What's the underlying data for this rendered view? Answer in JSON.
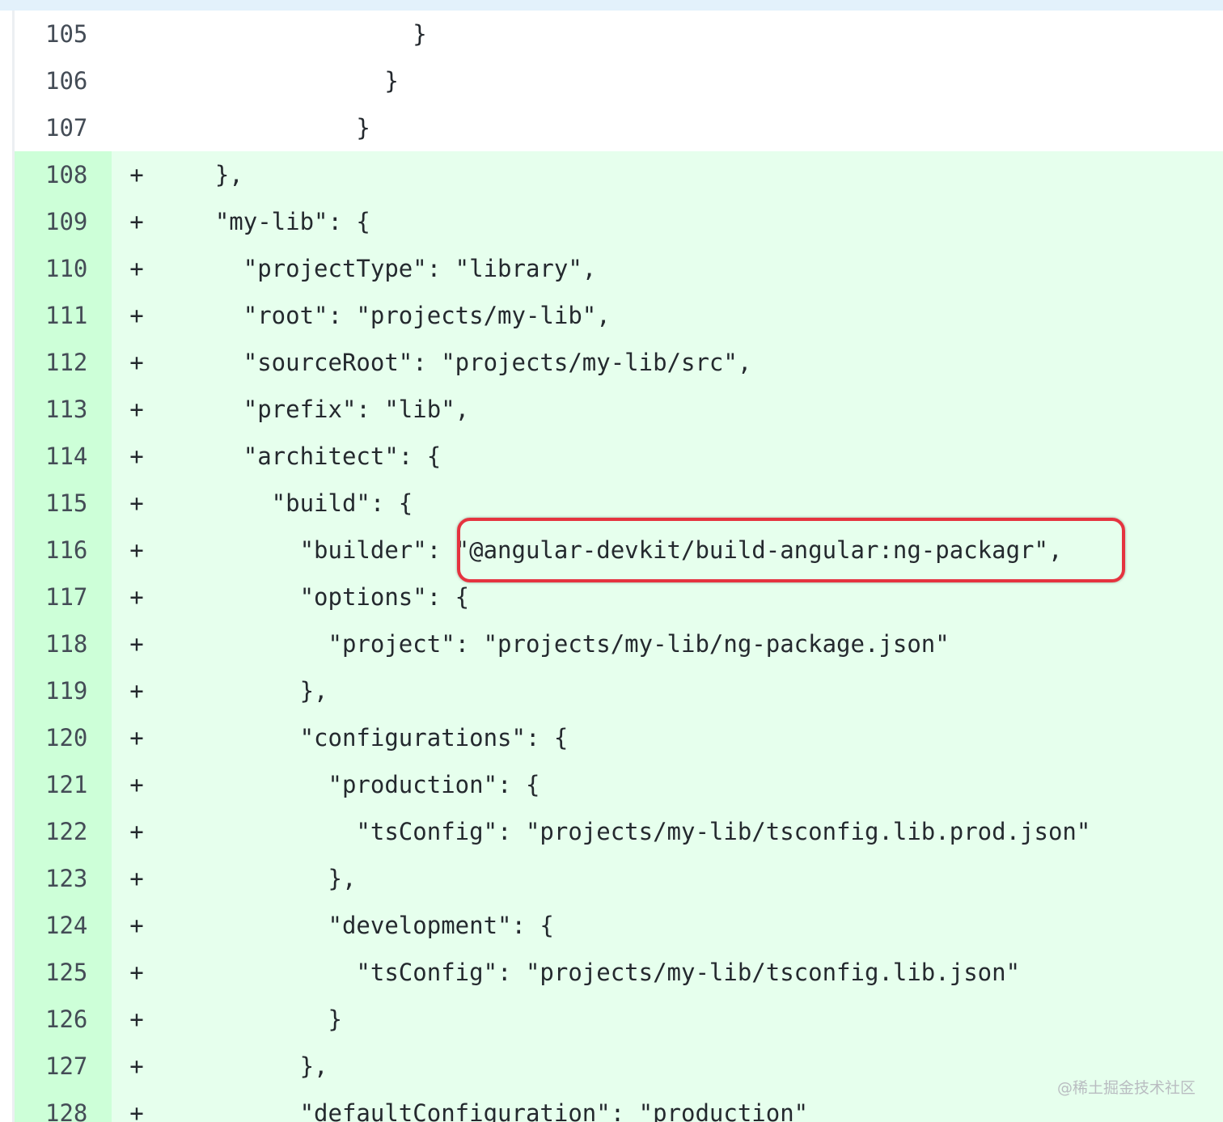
{
  "diff": {
    "lines": [
      {
        "num": "105",
        "sign": "",
        "type": "context",
        "code": "                  }"
      },
      {
        "num": "106",
        "sign": "",
        "type": "context",
        "code": "                }"
      },
      {
        "num": "107",
        "sign": "",
        "type": "context",
        "code": "              }"
      },
      {
        "num": "108",
        "sign": "+",
        "type": "added",
        "code": "    },"
      },
      {
        "num": "109",
        "sign": "+",
        "type": "added",
        "code": "    \"my-lib\": {"
      },
      {
        "num": "110",
        "sign": "+",
        "type": "added",
        "code": "      \"projectType\": \"library\","
      },
      {
        "num": "111",
        "sign": "+",
        "type": "added",
        "code": "      \"root\": \"projects/my-lib\","
      },
      {
        "num": "112",
        "sign": "+",
        "type": "added",
        "code": "      \"sourceRoot\": \"projects/my-lib/src\","
      },
      {
        "num": "113",
        "sign": "+",
        "type": "added",
        "code": "      \"prefix\": \"lib\","
      },
      {
        "num": "114",
        "sign": "+",
        "type": "added",
        "code": "      \"architect\": {"
      },
      {
        "num": "115",
        "sign": "+",
        "type": "added",
        "code": "        \"build\": {"
      },
      {
        "num": "116",
        "sign": "+",
        "type": "added",
        "code": "          \"builder\": \"@angular-devkit/build-angular:ng-packagr\","
      },
      {
        "num": "117",
        "sign": "+",
        "type": "added",
        "code": "          \"options\": {"
      },
      {
        "num": "118",
        "sign": "+",
        "type": "added",
        "code": "            \"project\": \"projects/my-lib/ng-package.json\""
      },
      {
        "num": "119",
        "sign": "+",
        "type": "added",
        "code": "          },"
      },
      {
        "num": "120",
        "sign": "+",
        "type": "added",
        "code": "          \"configurations\": {"
      },
      {
        "num": "121",
        "sign": "+",
        "type": "added",
        "code": "            \"production\": {"
      },
      {
        "num": "122",
        "sign": "+",
        "type": "added",
        "code": "              \"tsConfig\": \"projects/my-lib/tsconfig.lib.prod.json\""
      },
      {
        "num": "123",
        "sign": "+",
        "type": "added",
        "code": "            },"
      },
      {
        "num": "124",
        "sign": "+",
        "type": "added",
        "code": "            \"development\": {"
      },
      {
        "num": "125",
        "sign": "+",
        "type": "added",
        "code": "              \"tsConfig\": \"projects/my-lib/tsconfig.lib.json\""
      },
      {
        "num": "126",
        "sign": "+",
        "type": "added",
        "code": "            }"
      },
      {
        "num": "127",
        "sign": "+",
        "type": "added",
        "code": "          },"
      },
      {
        "num": "128",
        "sign": "+",
        "type": "added",
        "code": "          \"defaultConfiguration\": \"production\""
      }
    ]
  },
  "colors": {
    "added_bg": "#e6ffed",
    "added_gutter_bg": "#cdffd8",
    "highlight_border": "#e5333f"
  },
  "watermark": "@稀土掘金技术社区"
}
